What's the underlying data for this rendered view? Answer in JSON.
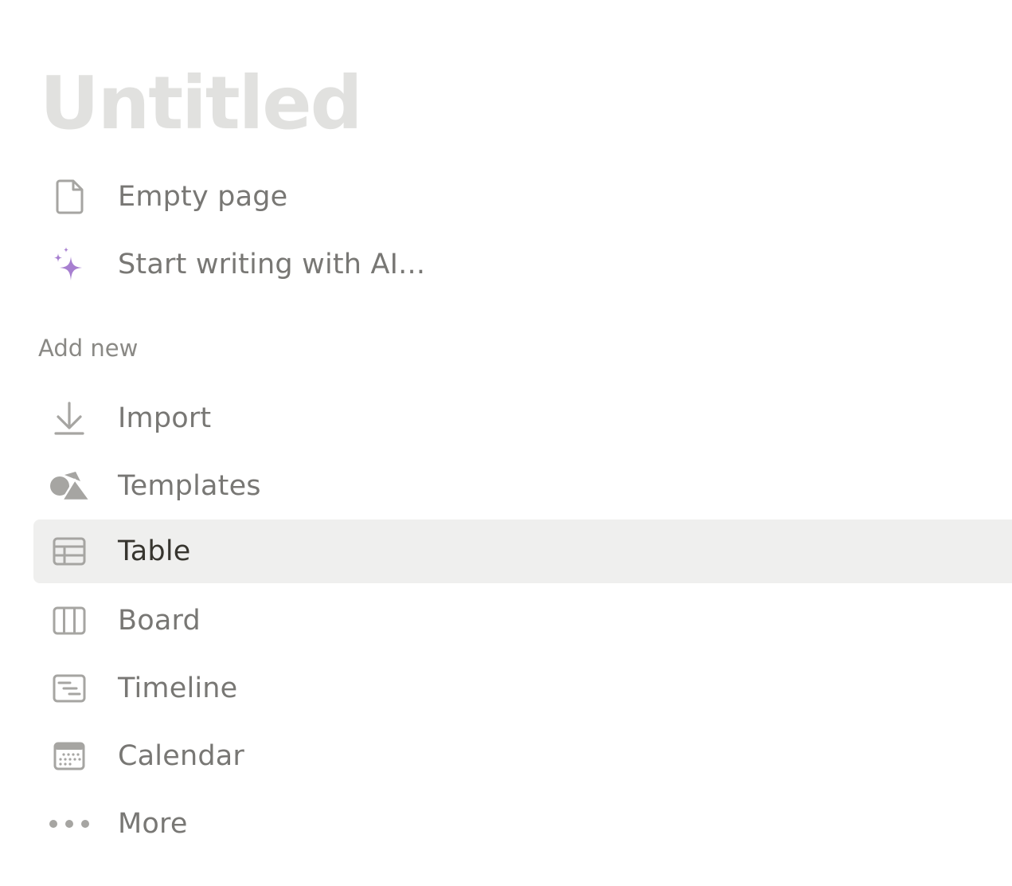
{
  "page": {
    "title": "Untitled"
  },
  "quick_actions": [
    {
      "label": "Empty page",
      "icon": "document-icon"
    },
    {
      "label": "Start writing with AI...",
      "icon": "sparkle-icon"
    }
  ],
  "add_new": {
    "heading": "Add new",
    "items": [
      {
        "label": "Import",
        "icon": "download-icon"
      },
      {
        "label": "Templates",
        "icon": "shapes-icon"
      },
      {
        "label": "Table",
        "icon": "table-icon",
        "selected": true
      },
      {
        "label": "Board",
        "icon": "board-icon"
      },
      {
        "label": "Timeline",
        "icon": "timeline-icon"
      },
      {
        "label": "Calendar",
        "icon": "calendar-icon"
      },
      {
        "label": "More",
        "icon": "more-icon"
      }
    ]
  },
  "colors": {
    "title_placeholder": "#e1e1df",
    "label": "#787774",
    "label_active": "#37352f",
    "icon": "#a6a5a2",
    "ai_accent": "#a77fd0",
    "selected_row_bg": "#efefee"
  }
}
